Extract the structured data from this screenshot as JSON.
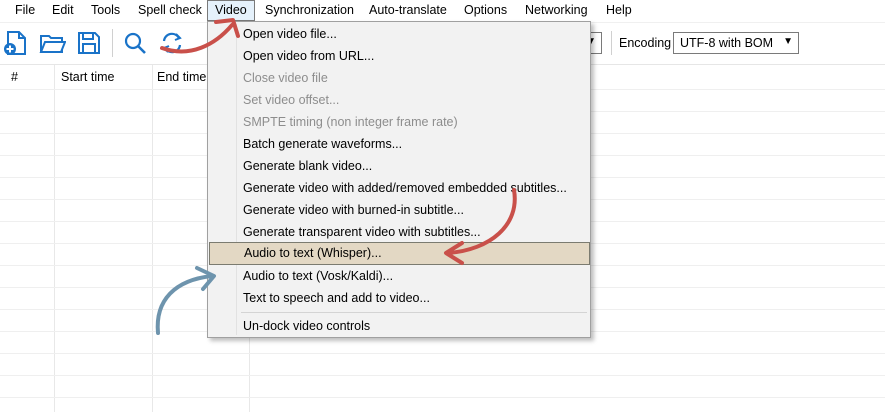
{
  "menubar": {
    "items": [
      {
        "label": "File"
      },
      {
        "label": "Edit"
      },
      {
        "label": "Tools"
      },
      {
        "label": "Spell check"
      },
      {
        "label": "Video"
      },
      {
        "label": "Synchronization"
      },
      {
        "label": "Auto-translate"
      },
      {
        "label": "Options"
      },
      {
        "label": "Networking"
      },
      {
        "label": "Help"
      }
    ]
  },
  "toolbar": {
    "icons": [
      "new-file-icon",
      "open-folder-icon",
      "save-icon",
      "find-icon",
      "replace-icon"
    ],
    "encoding_label": "Encoding",
    "encoding_value": "UTF-8 with BOM"
  },
  "grid": {
    "headers": {
      "number": "#",
      "start": "Start time",
      "end": "End time"
    }
  },
  "video_menu": {
    "items": [
      {
        "label": "Open video file...",
        "enabled": true
      },
      {
        "label": "Open video from URL...",
        "enabled": true
      },
      {
        "label": "Close video file",
        "enabled": false
      },
      {
        "label": "Set video offset...",
        "enabled": false
      },
      {
        "label": "SMPTE timing (non integer frame rate)",
        "enabled": false
      },
      {
        "label": "Batch generate waveforms...",
        "enabled": true
      },
      {
        "label": "Generate blank video...",
        "enabled": true
      },
      {
        "label": "Generate video with added/removed embedded subtitles...",
        "enabled": true
      },
      {
        "label": "Generate video with burned-in subtitle...",
        "enabled": true
      },
      {
        "label": "Generate transparent video with subtitles...",
        "enabled": true
      },
      {
        "label": "Audio to text (Whisper)...",
        "enabled": true,
        "highlighted": true
      },
      {
        "label": "Audio to text (Vosk/Kaldi)...",
        "enabled": true
      },
      {
        "label": "Text to speech and add to video...",
        "enabled": true
      },
      {
        "label": "Un-dock video controls",
        "enabled": true
      }
    ]
  },
  "colors": {
    "accent_blue": "#1a73c8",
    "highlight": "#e3d8c4",
    "arrow_red": "#c9504a",
    "arrow_blue": "#6e94ad"
  }
}
